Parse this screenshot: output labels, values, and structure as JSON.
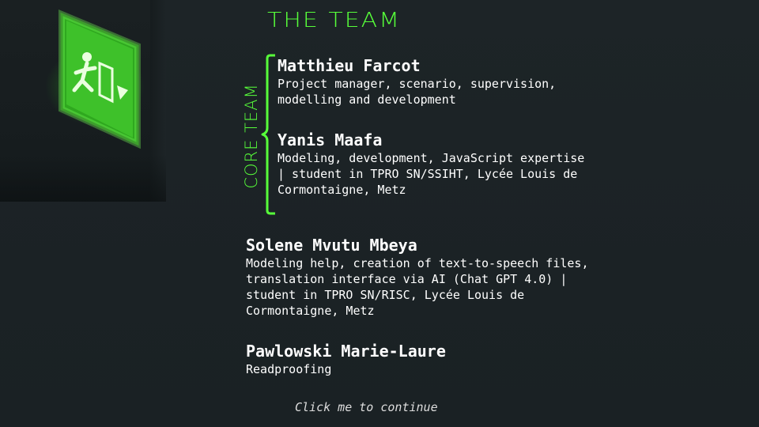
{
  "title": "The Team",
  "core_team_label": "Core Team",
  "members": [
    {
      "name": "Matthieu Farcot",
      "role": "Project manager, scenario, supervision,\nmodelling and development"
    },
    {
      "name": "Yanis Maafa",
      "role": "Modeling, development, JavaScript expertise\n| student in TPRO SN/SSIHT, Lycée Louis de\nCormontaigne, Metz"
    },
    {
      "name": "Solene Mvutu Mbeya",
      "role": "Modeling help, creation of text-to-speech files,\ntranslation interface via AI (Chat GPT 4.0) |\nstudent in TPRO SN/RISC, Lycée Louis de\nCormontaigne, Metz"
    },
    {
      "name": "Pawlowski Marie-Laure",
      "role": "Readproofing"
    }
  ],
  "continue_prompt": "Click me to continue",
  "colors": {
    "accent": "#57ff3a",
    "background": "#1c2326",
    "text": "#ffffff"
  },
  "icons": {
    "exit_sign": "emergency-exit-sign"
  }
}
